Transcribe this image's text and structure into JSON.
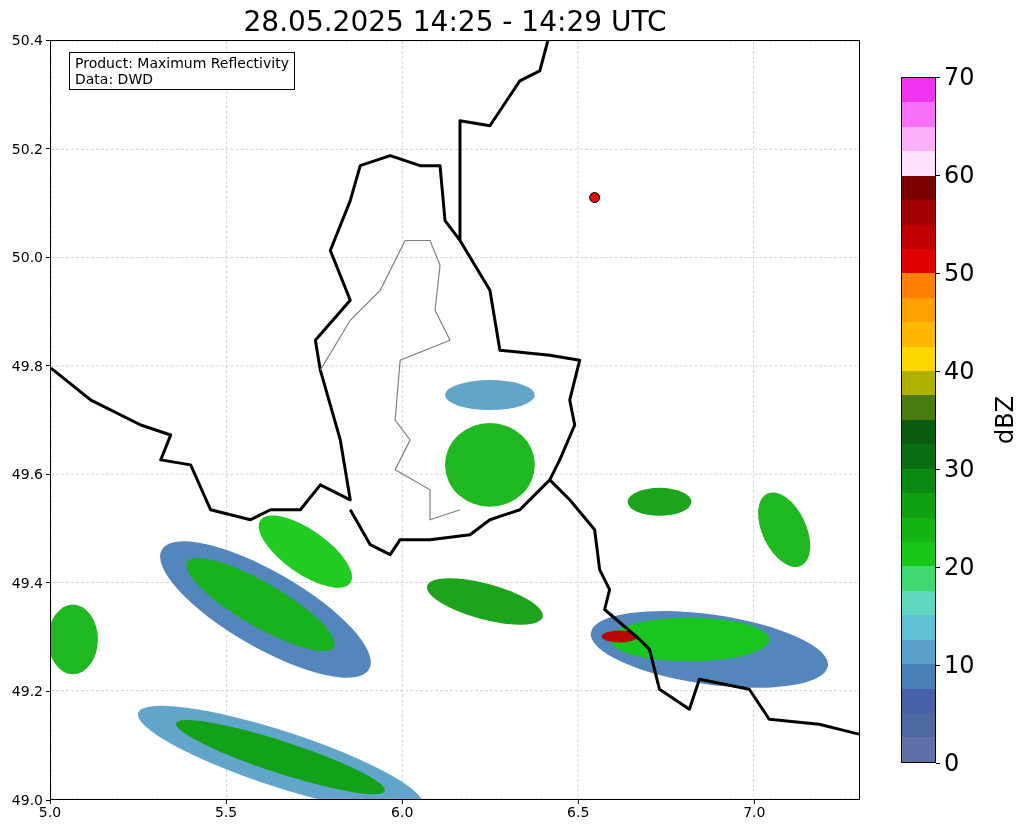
{
  "title": "28.05.2025 14:25 - 14:29 UTC",
  "legend": {
    "lines": [
      "Product: Maximum Reflectivity",
      "Data: DWD"
    ]
  },
  "x_axis": {
    "ticks": [
      "5.0",
      "5.5",
      "6.0",
      "6.5",
      "7.0"
    ]
  },
  "y_axis": {
    "ticks": [
      "50.4",
      "50.2",
      "50.0",
      "49.8",
      "49.6",
      "49.4",
      "49.2",
      "49.0"
    ]
  },
  "colorbar": {
    "label": "dBZ",
    "ticks": [
      "70",
      "60",
      "50",
      "40",
      "30",
      "20",
      "10",
      "0"
    ],
    "segments": [
      {
        "color": "#6070a8"
      },
      {
        "color": "#5068a0"
      },
      {
        "color": "#4860a8"
      },
      {
        "color": "#4a80b8"
      },
      {
        "color": "#58a0c8"
      },
      {
        "color": "#60c0d8"
      },
      {
        "color": "#60d8c0"
      },
      {
        "color": "#40d870"
      },
      {
        "color": "#16c816"
      },
      {
        "color": "#14b414"
      },
      {
        "color": "#10a010"
      },
      {
        "color": "#0a8a10"
      },
      {
        "color": "#0a6e10"
      },
      {
        "color": "#0a5a10"
      },
      {
        "color": "#4a7a10"
      },
      {
        "color": "#b0b000"
      },
      {
        "color": "#ffd800"
      },
      {
        "color": "#ffb800"
      },
      {
        "color": "#ffa000"
      },
      {
        "color": "#ff8000"
      },
      {
        "color": "#e00000"
      },
      {
        "color": "#c00000"
      },
      {
        "color": "#a00000"
      },
      {
        "color": "#780000"
      },
      {
        "color": "#fde0fd"
      },
      {
        "color": "#fcb0fc"
      },
      {
        "color": "#f870f8"
      },
      {
        "color": "#f035f0"
      }
    ]
  }
}
